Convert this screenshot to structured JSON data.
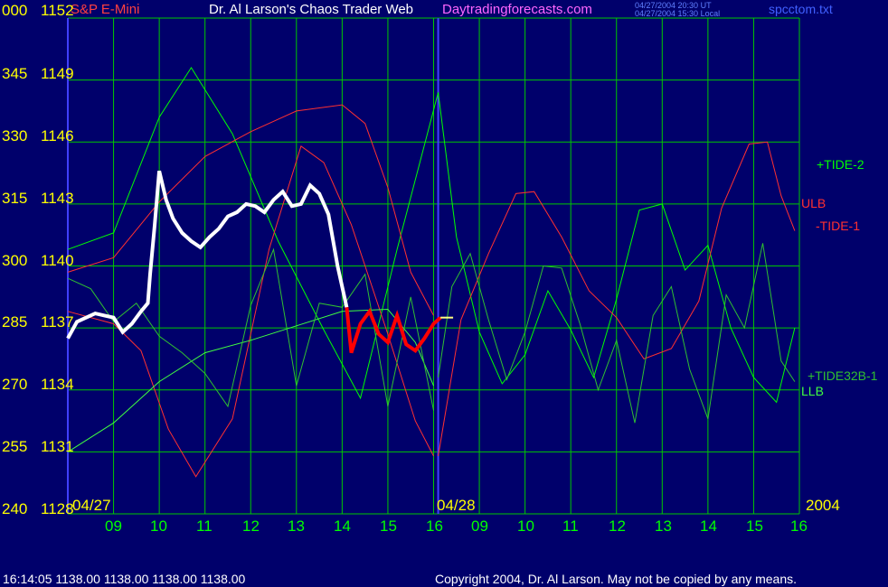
{
  "header": {
    "instrument": "S&P E-Mini",
    "title": "Dr. Al Larson's Chaos Trader Web",
    "site": "Daytradingforecasts.com",
    "time_ut": "04/27/2004 20:30 UT",
    "time_local": "04/27/2004 15:30 Local",
    "file": "spcctom.txt"
  },
  "footer": {
    "quote": "16:14:05  1138.00 1138.00 1138.00 1138.00",
    "copyright": "Copyright 2004, Dr. Al Larson. May not be copied by any means."
  },
  "colors": {
    "background": "#00006b",
    "grid": "#00c800",
    "price_white": "#ffffff",
    "price_red": "#ff0000",
    "tide": "#00ff00",
    "ulb": "#ff3030",
    "llb": "#40ff40",
    "axis_text": "#ffff00",
    "hour_text": "#00ff00"
  },
  "chart_data": {
    "type": "line",
    "title": "S&P E-Mini",
    "ylim": [
      1128,
      1152
    ],
    "y_ticks": [
      {
        "angle": "000",
        "price": 1152
      },
      {
        "angle": "345",
        "price": 1149
      },
      {
        "angle": "330",
        "price": 1146
      },
      {
        "angle": "315",
        "price": 1143
      },
      {
        "angle": "300",
        "price": 1140
      },
      {
        "angle": "285",
        "price": 1137
      },
      {
        "angle": "270",
        "price": 1134
      },
      {
        "angle": "255",
        "price": 1131
      },
      {
        "angle": "240",
        "price": 1128
      }
    ],
    "x_ticks": [
      "09",
      "10",
      "11",
      "12",
      "13",
      "14",
      "15",
      "16",
      "09",
      "10",
      "11",
      "12",
      "13",
      "14",
      "15",
      "16"
    ],
    "date_labels": [
      "04/27",
      "04/28",
      "2004"
    ],
    "series_labels": [
      "+TIDE-2",
      "ULB",
      "-TIDE-1",
      "+TIDE32B-1",
      "LLB"
    ],
    "price_series": {
      "x_hours": [
        0.0,
        0.2,
        0.4,
        0.6,
        0.8,
        1.0,
        1.2,
        1.4,
        1.6,
        1.75,
        1.8,
        1.9,
        2.0,
        2.15,
        2.3,
        2.5,
        2.7,
        2.9,
        3.1,
        3.3,
        3.5,
        3.7,
        3.9,
        4.1,
        4.3,
        4.5,
        4.7,
        4.9,
        5.1,
        5.3,
        5.5,
        5.7,
        5.9,
        6.1,
        6.2,
        6.4,
        6.6,
        6.8,
        7.0,
        7.2,
        7.4,
        7.6,
        7.8,
        8.0,
        8.15
      ],
      "values": [
        1136.5,
        1137.3,
        1137.5,
        1137.7,
        1137.6,
        1137.5,
        1136.8,
        1137.2,
        1137.8,
        1138.2,
        1139.6,
        1142.0,
        1144.6,
        1143.2,
        1142.3,
        1141.6,
        1141.2,
        1140.9,
        1141.4,
        1141.8,
        1142.4,
        1142.6,
        1143.0,
        1142.9,
        1142.6,
        1143.2,
        1143.6,
        1142.9,
        1143.0,
        1143.9,
        1143.5,
        1142.5,
        1140.0,
        1138.0,
        1135.8,
        1137.2,
        1137.8,
        1136.7,
        1136.3,
        1137.6,
        1136.2,
        1135.9,
        1136.5,
        1137.2,
        1137.5
      ]
    },
    "series": [
      {
        "name": "+TIDE-2",
        "x_hours": [
          0,
          1.0,
          2.0,
          2.7,
          3.6,
          4.6,
          5.6,
          6.4,
          7.2,
          8.1
        ],
        "values": [
          1140.8,
          1141.6,
          1147.2,
          1149.6,
          1146.4,
          1141.2,
          1136.9,
          1133.6,
          1140.8,
          1148.4
        ]
      },
      {
        "name": "-TIDE-1",
        "x_hours": [
          0,
          1.0,
          1.6,
          2.2,
          2.8,
          3.6,
          4.4,
          5.1,
          5.6,
          6.2,
          7.0,
          7.6,
          8.0
        ],
        "values": [
          1137.8,
          1137.2,
          1135.9,
          1132.1,
          1129.8,
          1132.6,
          1140.8,
          1145.8,
          1145.0,
          1142.0,
          1136.7,
          1132.5,
          1130.8
        ]
      },
      {
        "name": "ULB",
        "x_hours": [
          0,
          1.0,
          2.0,
          3.0,
          4.0,
          5.0,
          6.0,
          6.5,
          7.0,
          7.5,
          8.0
        ],
        "values": [
          1139.7,
          1140.4,
          1143.1,
          1145.3,
          1146.5,
          1147.5,
          1147.8,
          1146.9,
          1143.8,
          1139.7,
          1137.6
        ]
      },
      {
        "name": "LLB",
        "x_hours": [
          0,
          1.0,
          2.0,
          3.0,
          4.0,
          5.0,
          6.0,
          7.0,
          7.6,
          8.0
        ],
        "values": [
          1131.0,
          1132.4,
          1134.4,
          1135.8,
          1136.4,
          1137.1,
          1137.8,
          1137.9,
          1136.3,
          1134.2
        ]
      },
      {
        "name": "+TIDE32B-1",
        "x_hours": [
          0,
          0.5,
          1.0,
          1.5,
          2.0,
          2.5,
          3.0,
          3.5,
          4.0,
          4.5,
          5.0,
          5.5,
          6.0,
          6.5,
          7.0,
          7.5,
          8.0
        ],
        "values": [
          1139.4,
          1138.9,
          1137.3,
          1138.2,
          1136.6,
          1135.8,
          1134.8,
          1133.2,
          1138.1,
          1140.8,
          1134.2,
          1138.2,
          1138.0,
          1139.6,
          1133.2,
          1138.5,
          1133.0
        ]
      }
    ],
    "forecast": [
      {
        "name": "+TIDE-2",
        "x_hours": [
          8.1,
          8.5,
          9.0,
          9.5,
          10.0,
          10.5,
          11.0,
          11.5,
          12.0,
          12.5,
          13.0,
          13.5,
          14.0,
          14.5,
          15.0,
          15.5,
          15.9
        ],
        "values": [
          1148.4,
          1141.4,
          1136.8,
          1134.3,
          1135.7,
          1138.8,
          1136.9,
          1134.6,
          1138.4,
          1142.7,
          1143.0,
          1139.8,
          1141.0,
          1137.0,
          1134.6,
          1133.4,
          1137.0
        ]
      },
      {
        "name": "-TIDE-1",
        "x_hours": [
          8.1,
          8.6,
          9.2,
          9.8,
          10.2,
          10.8,
          11.4,
          12.0,
          12.6,
          13.2,
          13.8,
          14.3,
          14.9,
          15.3,
          15.6,
          15.9
        ],
        "values": [
          1130.8,
          1137.4,
          1140.6,
          1143.5,
          1143.6,
          1141.4,
          1138.8,
          1137.5,
          1135.5,
          1136.0,
          1138.3,
          1142.8,
          1145.9,
          1146.0,
          1143.4,
          1141.7
        ]
      },
      {
        "name": "+TIDE32B-1",
        "x_hours": [
          8.1,
          8.4,
          8.8,
          9.2,
          9.6,
          10.0,
          10.4,
          10.8,
          11.2,
          11.6,
          12.0,
          12.4,
          12.8,
          13.2,
          13.6,
          14.0,
          14.4,
          14.8,
          15.2,
          15.6,
          15.9
        ],
        "values": [
          1134.6,
          1139.0,
          1140.6,
          1137.4,
          1134.5,
          1136.8,
          1140.0,
          1139.9,
          1137.2,
          1134.0,
          1136.4,
          1132.4,
          1137.6,
          1139.0,
          1135.0,
          1132.6,
          1138.6,
          1137.0,
          1141.1,
          1135.4,
          1134.4
        ]
      }
    ]
  }
}
